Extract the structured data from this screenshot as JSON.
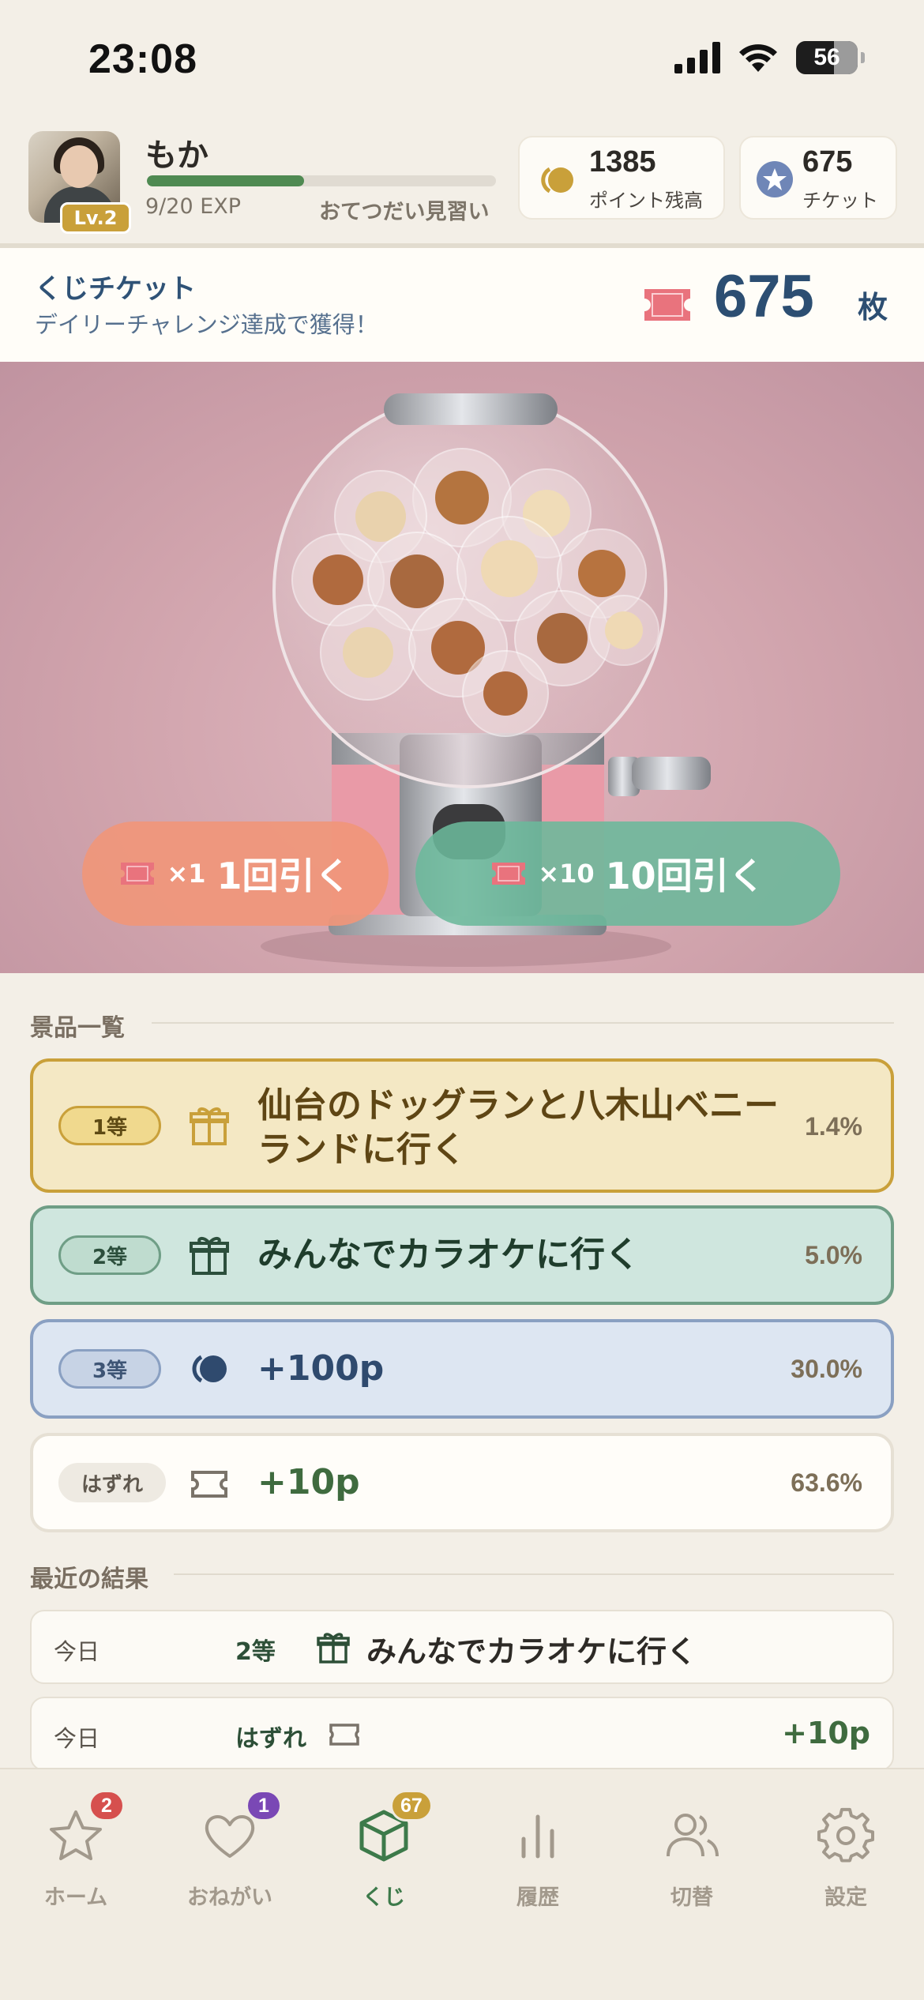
{
  "status_bar": {
    "time": "23:08",
    "battery": "56"
  },
  "user": {
    "name": "もか",
    "level": "Lv.2",
    "exp_text": "9/20 EXP",
    "exp_progress": 0.45,
    "rank": "おてつだい見習い"
  },
  "stats": {
    "points": {
      "value": "1385",
      "label": "ポイント残高"
    },
    "tickets": {
      "value": "675",
      "label": "チケット"
    }
  },
  "ticket_bar": {
    "title": "くじチケット",
    "subtitle": "デイリーチャレンジ達成で獲得！",
    "count": "675",
    "unit": "枚"
  },
  "draw_buttons": {
    "single": {
      "multiplier": "×1",
      "label": "1回引く"
    },
    "ten": {
      "multiplier": "×10",
      "label": "10回引く"
    }
  },
  "prizes_section": {
    "title": "景品一覧"
  },
  "prizes": [
    {
      "rank": "1等",
      "name_line1": "仙台のドッグランと八木山ベニー",
      "name_line2": "ランドに行く",
      "probability": "1.4%",
      "icon": "gift-icon",
      "color": "#c9a03a"
    },
    {
      "rank": "2等",
      "name": "みんなでカラオケに行く",
      "probability": "5.0%",
      "icon": "gift-icon",
      "color": "#6f9e86"
    },
    {
      "rank": "3等",
      "name": "+100p",
      "probability": "30.0%",
      "icon": "coin-icon",
      "color": "#8aa0c2"
    },
    {
      "rank": "はずれ",
      "name": "+10p",
      "probability": "63.6%",
      "icon": "ticket-icon",
      "color": "#e6e0d4"
    }
  ],
  "recent_section": {
    "title": "最近の結果"
  },
  "recent_results": [
    {
      "day": "今日",
      "rank": "2等",
      "icon": "gift-icon",
      "name": "みんなでカラオケに行く",
      "points": ""
    },
    {
      "day": "今日",
      "rank": "はずれ",
      "icon": "ticket-icon",
      "name": "",
      "points": "+10p"
    }
  ],
  "tabs": [
    {
      "label": "ホーム",
      "icon": "star-icon",
      "badge": "2",
      "badge_color": "#d6504e"
    },
    {
      "label": "おねがい",
      "icon": "heart-icon",
      "badge": "1",
      "badge_color": "#7a48b5"
    },
    {
      "label": "くじ",
      "icon": "box-icon",
      "badge": "67",
      "badge_color": "#c9a03a",
      "active": true
    },
    {
      "label": "履歴",
      "icon": "chart-icon"
    },
    {
      "label": "切替",
      "icon": "users-icon"
    },
    {
      "label": "設定",
      "icon": "gear-icon"
    }
  ]
}
